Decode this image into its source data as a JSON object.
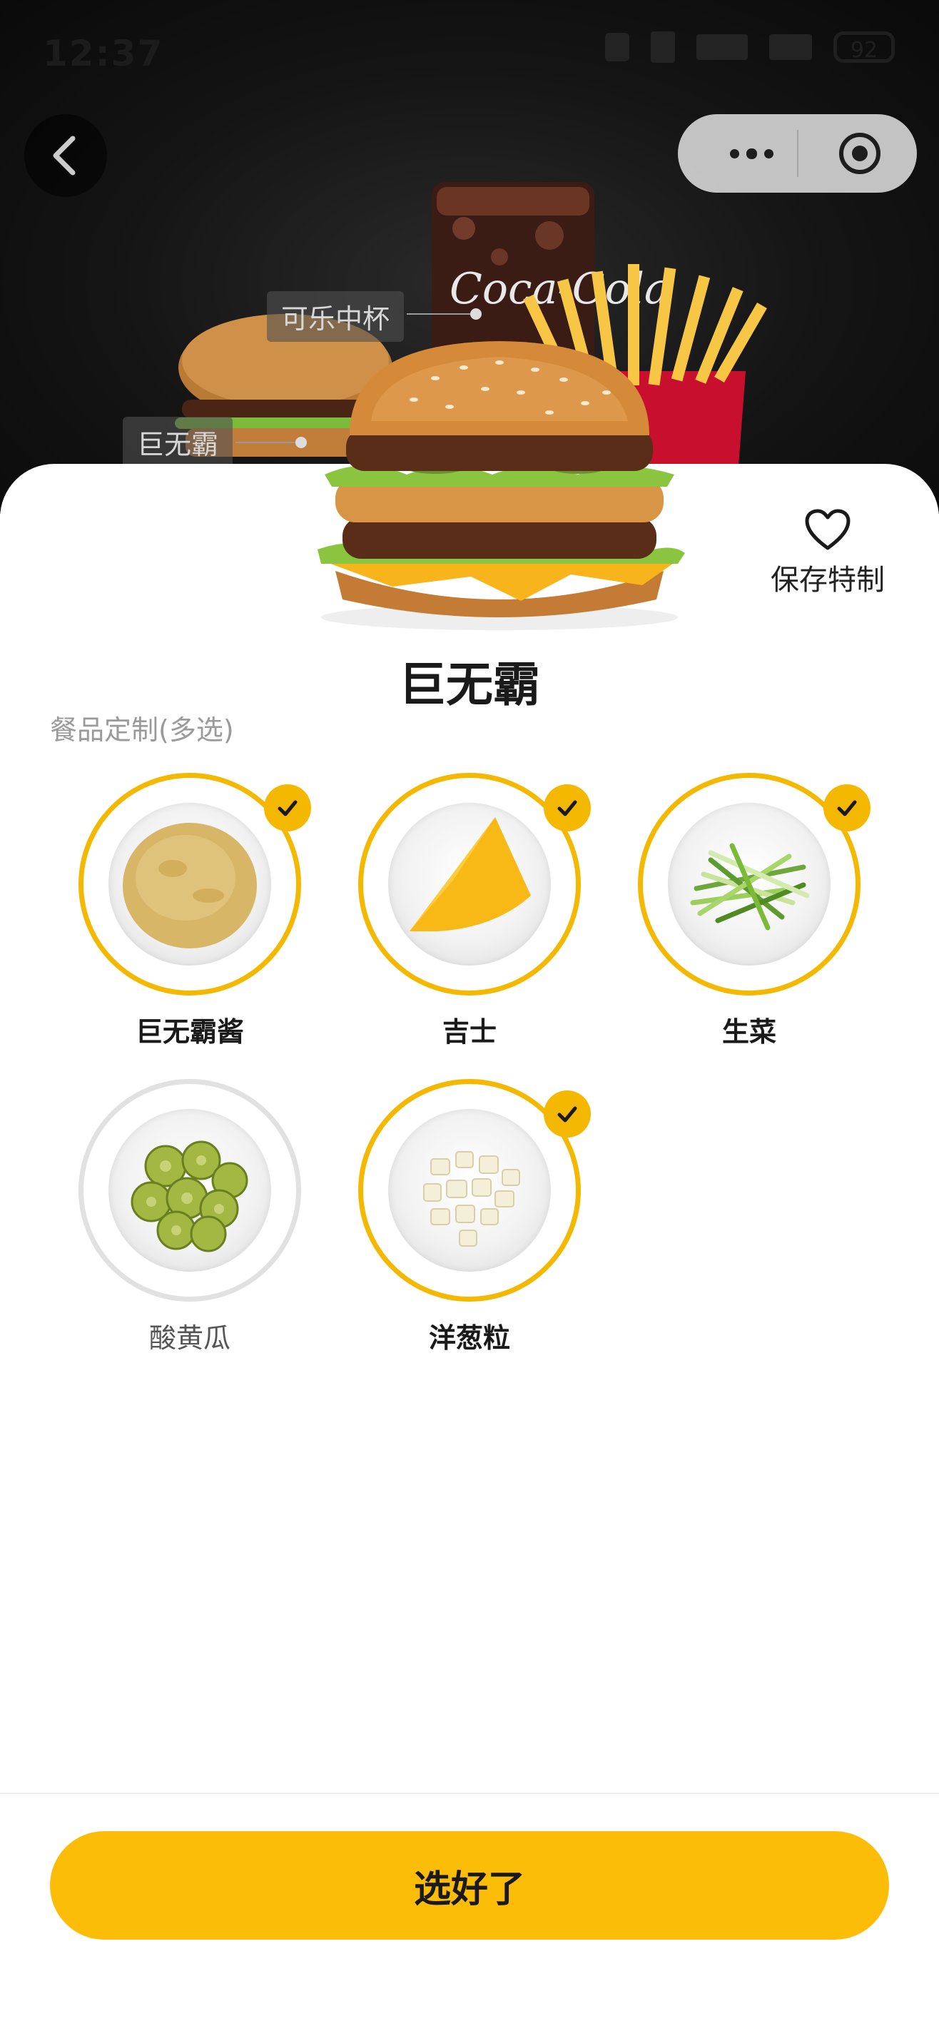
{
  "status_bar": {
    "time": "12:37",
    "battery": "92"
  },
  "hero": {
    "tags": {
      "cola": "可乐中杯",
      "big_mac": "巨无霸"
    }
  },
  "save": {
    "label": "保存特制"
  },
  "product": {
    "title": "巨无霸"
  },
  "section": {
    "label": "餐品定制(多选)"
  },
  "options": [
    {
      "name": "巨无霸酱",
      "selected": true
    },
    {
      "name": "吉士",
      "selected": true
    },
    {
      "name": "生菜",
      "selected": true
    },
    {
      "name": "酸黄瓜",
      "selected": false
    },
    {
      "name": "洋葱粒",
      "selected": true
    }
  ],
  "confirm": {
    "label": "选好了"
  },
  "colors": {
    "accent": "#fbbd08",
    "ring_selected": "#f5b800",
    "ring_unselected": "#e1e1e1"
  }
}
